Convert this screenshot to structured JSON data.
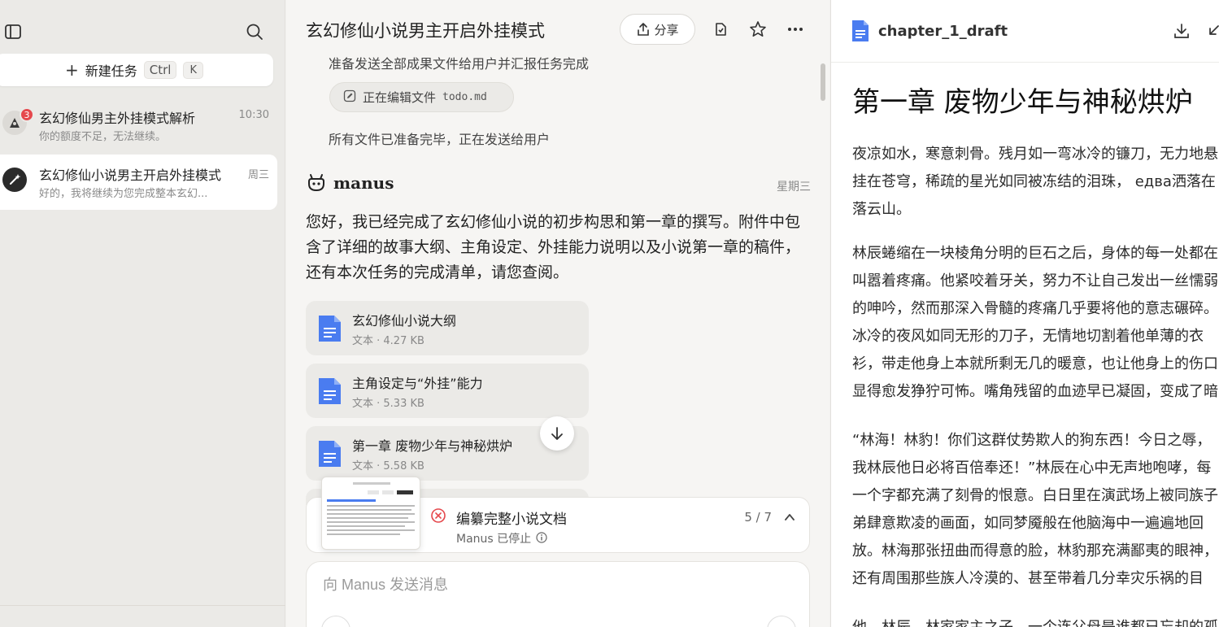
{
  "sidebar": {
    "new_task_label": "新建任务",
    "shortcut_ctrl": "Ctrl",
    "shortcut_k": "K",
    "tasks": [
      {
        "title": "玄幻修仙男主外挂模式解析",
        "subtitle": "你的额度不足，无法继续。",
        "time": "10:30",
        "badge": "3"
      },
      {
        "title": "玄幻修仙小说男主开启外挂模式",
        "subtitle": "好的，我将继续为您完成整本玄幻...",
        "time": "周三"
      }
    ]
  },
  "chat": {
    "title": "玄幻修仙小说男主开启外挂模式",
    "share_label": "分享",
    "lines": {
      "prepare_send": "准备发送全部成果文件给用户并汇报任务完成",
      "editing_label": "正在编辑文件",
      "editing_file": "todo.md",
      "all_ready": "所有文件已准备完毕，正在发送给用户"
    },
    "agent_name": "manus",
    "agent_day": "星期三",
    "message": "您好，我已经完成了玄幻修仙小说的初步构思和第一章的撰写。附件中包含了详细的故事大纲、主角设定、外挂能力说明以及小说第一章的稿件，还有本次任务的完成清单，请您查阅。",
    "files": [
      {
        "name": "玄幻修仙小说大纲",
        "meta": "文本 · 4.27 KB"
      },
      {
        "name": "主角设定与“外挂”能力",
        "meta": "文本 · 5.33 KB"
      },
      {
        "name": "第一章 废物少年与神秘烘炉",
        "meta": "文本 · 5.58 KB"
      }
    ],
    "task_status": {
      "title": "编纂完整小说文档",
      "subtitle": "Manus 已停止",
      "progress": "5 / 7"
    },
    "composer_placeholder": "向 Manus 发送消息"
  },
  "doc": {
    "filename": "chapter_1_draft",
    "heading": "第一章 废物少年与神秘烘炉",
    "paragraphs": [
      "夜凉如水，寒意刺骨。残月如一弯冰冷的镰刀，无力地悬挂在苍穹，稀疏的星光如同被冻结的泪珠， едва洒落在落云山。",
      "林辰蜷缩在一块棱角分明的巨石之后，身体的每一处都在叫嚣着疼痛。他紧咬着牙关，努力不让自己发出一丝懦弱的呻吟，然而那深入骨髓的疼痛几乎要将他的意志碾碎。冰冷的夜风如同无形的刀子，无情地切割着他单薄的衣衫，带走他身上本就所剩无几的暖意，也让他身上的伤口显得愈发狰狞可怖。嘴角残留的血迹早已凝固，变成了暗红色，衬得他那张稚嫩却倔强的脸庞。",
      "“林海！林豹！你们这群仗势欺人的狗东西！今日之辱，我林辰他日必将百倍奉还！”林辰在心中无声地咆哮，每一个字都充满了刻骨的恨意。白日里在演武场上被同族子弟肆意欺凌的画面，如同梦魇般在他脑海中一遍遍地回放。林海那张扭曲而得意的脸，林豹那充满鄙夷的眼神，还有周围那些族人冷漠的、甚至带着几分幸灾乐祸的目光，都像一根根烧红的钢针，狠狠扎在他的心上，让他痛不欲生。",
      "他，林辰，林家家主之子，一个连父母是谁都已忘却的孤儿。"
    ]
  },
  "colors": {
    "accent_blue": "#4a7cf0",
    "badge_red": "#e5484d",
    "stop_red": "#e5484d"
  }
}
